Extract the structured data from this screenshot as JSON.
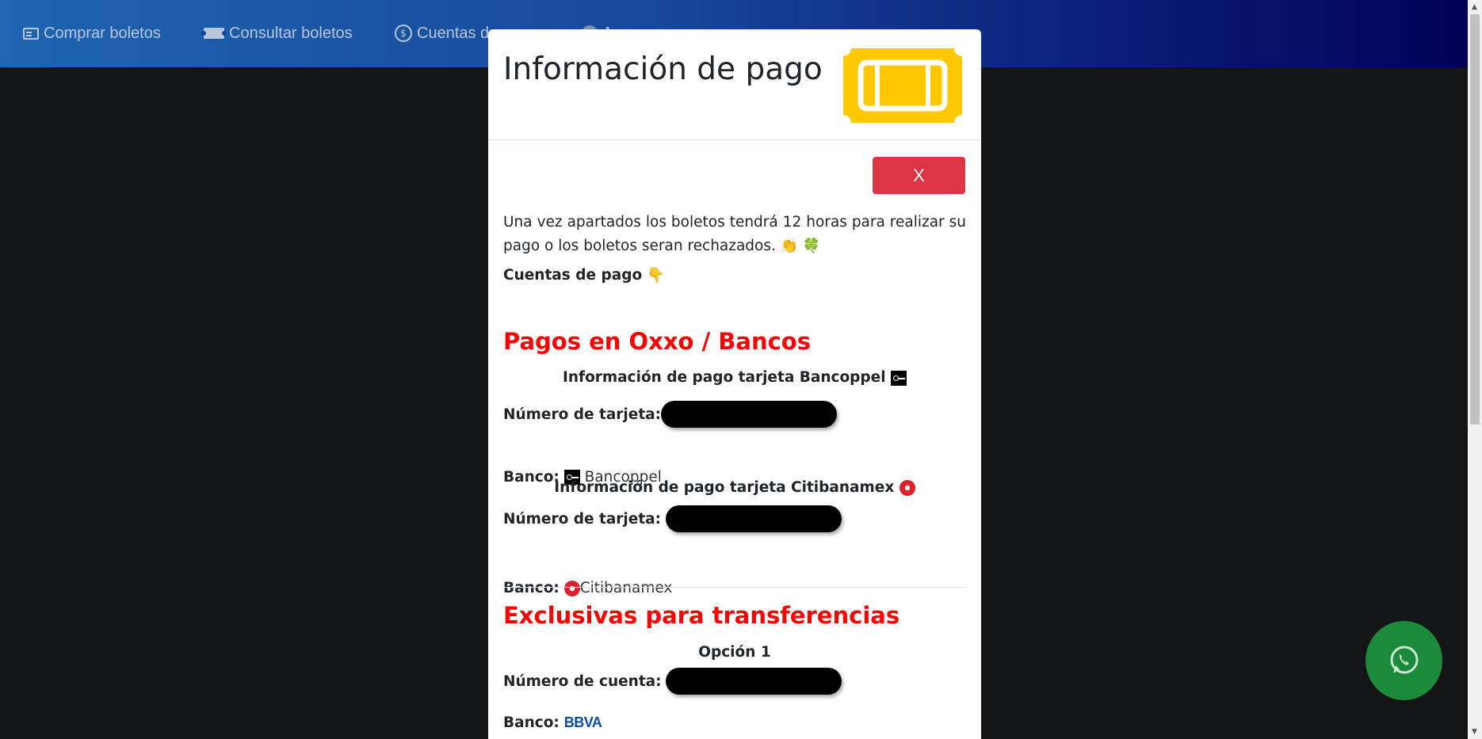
{
  "nav": {
    "items": [
      {
        "label": "Comprar boletos",
        "icon": "card-icon"
      },
      {
        "label": "Consultar boletos",
        "icon": "ticket-icon"
      },
      {
        "label": "Cuentas d",
        "icon": "coin-icon"
      },
      {
        "label": "A",
        "icon": "question-icon"
      }
    ]
  },
  "modal": {
    "title": "Información de pago",
    "close_label": "X",
    "intro": "Una vez apartados los boletos tendrá 12 horas para realizar su pago o los boletos seran rechazados.",
    "intro_emojis": "👏 🍀",
    "cuentas_label": "Cuentas de pago",
    "cuentas_emoji": "👇",
    "section1_title": "Pagos en Oxxo / Bancos",
    "bancoppel": {
      "heading": "Información de pago tarjeta Bancoppel",
      "card_label": "Número de tarjeta:",
      "bank_label": "Banco:",
      "bank_value": "Bancoppel"
    },
    "citibanamex": {
      "heading": "Información de pago tarjeta Citibanamex",
      "card_label": "Número de tarjeta:",
      "bank_label": "Banco:",
      "bank_value": "Citibanamex"
    },
    "section2_title": "Exclusivas para transferencias",
    "option1": {
      "heading": "Opción 1",
      "account_label": "Número de cuenta:",
      "bank_label": "Banco:",
      "bank_value": "BBVA"
    }
  },
  "colors": {
    "accent_red": "#ff0000",
    "close_button": "#dc3545",
    "whatsapp": "#1b8a3b",
    "ticket_yellow": "#ffc800"
  }
}
